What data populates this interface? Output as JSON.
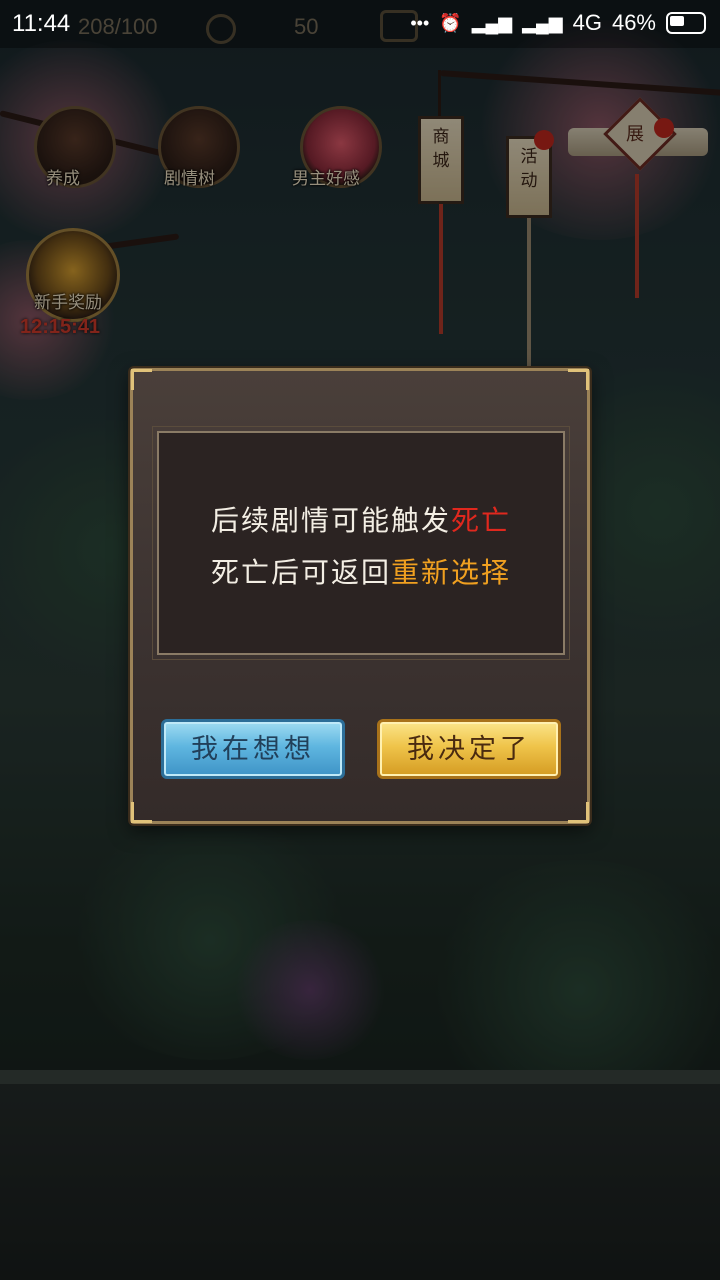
{
  "status_bar": {
    "time": "11:44",
    "signal_label": "4G",
    "battery": "46%"
  },
  "top_bar": {
    "stamina": "208/100",
    "coins": "50"
  },
  "menu": {
    "items": [
      {
        "label": "养成"
      },
      {
        "label": "剧情树"
      },
      {
        "label": "男主好感"
      },
      {
        "label": "新手奖励"
      }
    ],
    "newbie_timer": "12:15:41"
  },
  "lanterns": {
    "shop": "商城",
    "event": "活动",
    "expand": "展"
  },
  "dialog": {
    "line1_prefix": "后续剧情可能触发",
    "line1_highlight": "死亡",
    "line2_prefix": "死亡后可返回",
    "line2_highlight": "重新选择",
    "btn_think": "我在想想",
    "btn_confirm": "我决定了"
  },
  "colors": {
    "highlight_red": "#e0281e",
    "highlight_orange": "#f0a020",
    "button_blue": "#5fb6e0",
    "button_gold": "#efc44a"
  }
}
